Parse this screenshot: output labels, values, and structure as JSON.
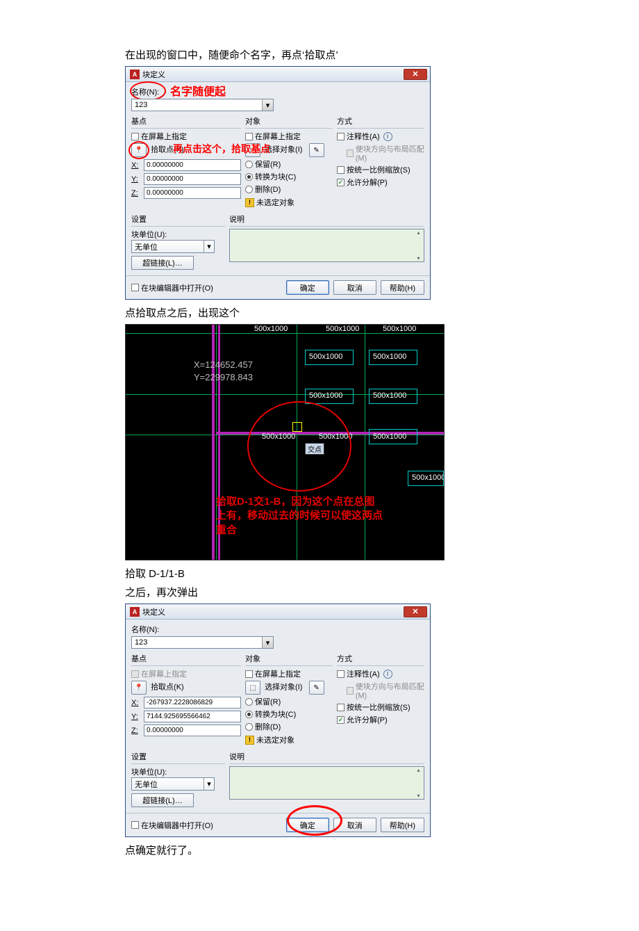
{
  "doc": {
    "p1": "在出现的窗口中，随便命个名字，再点‘拾取点’",
    "p2": "点拾取点之后，出现这个",
    "p3": "拾取 D-1/1-B",
    "p4": "之后，再次弹出",
    "p5": "点确定就行了。"
  },
  "anno": {
    "name_hint": "名字随便起",
    "pick_hint": "再点击这个，拾取基点"
  },
  "dialog": {
    "title": "块定义",
    "name_label": "名称(N):",
    "name_value": "123",
    "section_base": "基点",
    "section_object": "对象",
    "section_mode": "方式",
    "chk_screen": "在屏幕上指定",
    "pick_point": "拾取点(K)",
    "select_obj": "选择对象(I)",
    "x_label": "X:",
    "y_label": "Y:",
    "z_label": "Z:",
    "coord1": {
      "x": "0.00000000",
      "y": "0.00000000",
      "z": "0.00000000"
    },
    "coord2": {
      "x": "-267937.2228086829",
      "y": "7144.925695566462",
      "z": "0.00000000"
    },
    "radio_keep": "保留(R)",
    "radio_convert": "转换为块(C)",
    "radio_delete": "删除(D)",
    "no_selection": "未选定对象",
    "chk_annotative": "注释性(A)",
    "chk_orient": "使块方向与布局匹配(M)",
    "chk_uniform": "按统一比例缩放(S)",
    "chk_explode": "允许分解(P)",
    "section_settings": "设置",
    "block_unit_label": "块单位(U):",
    "block_unit_value": "无单位",
    "hyperlink": "超链接(L)…",
    "section_desc": "说明",
    "chk_open_editor": "在块编辑器中打开(O)",
    "btn_ok": "确定",
    "btn_cancel": "取消",
    "btn_help": "帮助(H)"
  },
  "cad": {
    "coord_x": "X=124652.457",
    "coord_y": "Y=229978.843",
    "dim_text": "500x1000",
    "tooltip": "交点",
    "note_line1": "拾取D-1交1-B，因为这个点在总图",
    "note_line2": "上有，移动过去的时候可以使这两点",
    "note_line3": "重合"
  }
}
